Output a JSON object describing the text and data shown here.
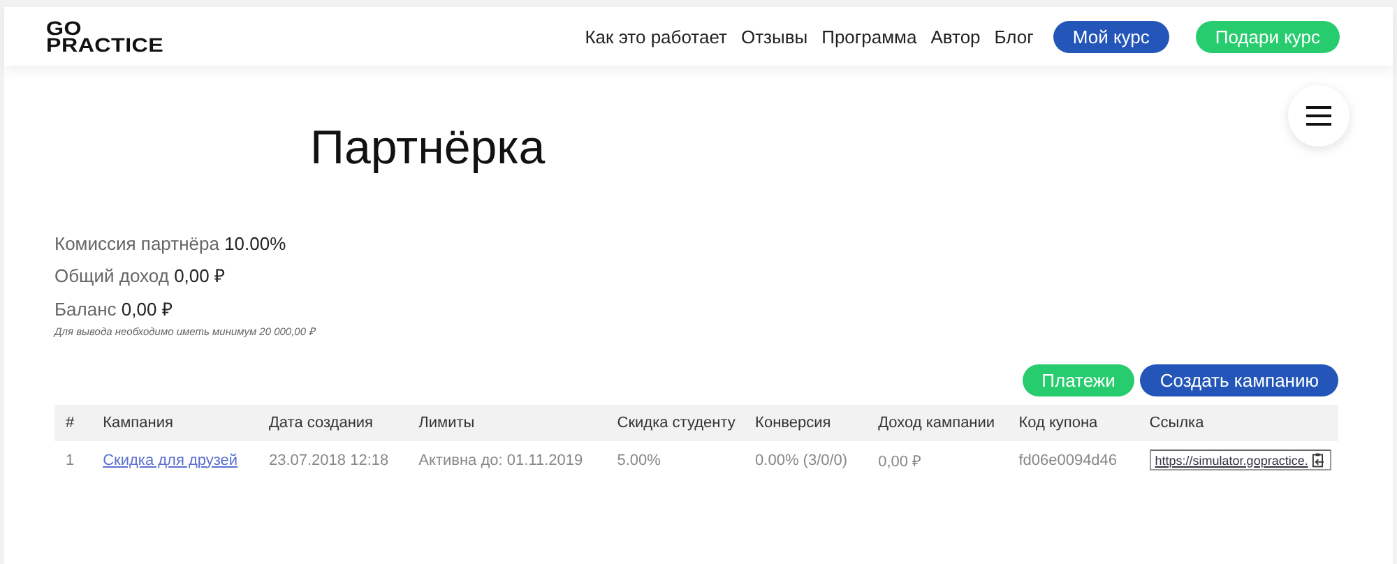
{
  "header": {
    "logo": [
      "GO",
      "PRACTICE"
    ],
    "nav": [
      "Как это работает",
      "Отзывы",
      "Программа",
      "Автор",
      "Блог"
    ],
    "buttons": [
      {
        "label": "Мой курс",
        "kind": "primary"
      },
      {
        "label": "Подари курс",
        "kind": "gift"
      }
    ]
  },
  "title": "Партнёрка",
  "stats": [
    "Комиссия партнёра **10.00%**",
    "Общий доход **0,00 ₽**",
    "Баланс **0,00 ₽**"
  ],
  "note": "Для вывода необходимо иметь минимум 20 000,00 ₽",
  "actions": [
    {
      "label": "Платежи",
      "kind": "gift"
    },
    {
      "label": "Создать кампанию",
      "kind": "primary"
    }
  ],
  "table": {
    "columns": [
      "#",
      "Кампания",
      "Дата создания",
      "Лимиты",
      "Скидка студенту",
      "Конверсия",
      "Доход кампании",
      "Код купона",
      "Ссылка"
    ],
    "rows": [
      {
        "cells": [
          "1",
          "Скидка для друзей",
          "23.07.2018 12:18",
          "Активна до: 01.11.2019",
          "5.00%",
          "0.00% (3/0/0)",
          "0,00 ₽",
          "fd06e0094d46",
          "https://simulator.gopractice."
        ]
      }
    ]
  }
}
